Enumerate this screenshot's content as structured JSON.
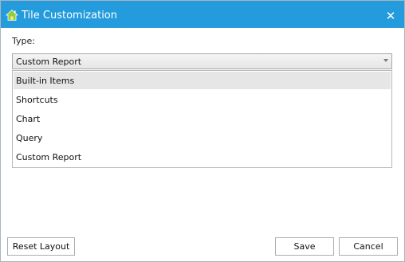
{
  "window": {
    "title": "Tile Customization",
    "close_glyph": "✕",
    "icon": "house-icon",
    "accent_color": "#239bdc"
  },
  "form": {
    "type_label": "Type:",
    "type_selected": "Custom Report",
    "type_options": [
      "Built-in Items",
      "Shortcuts",
      "Chart",
      "Query",
      "Custom Report"
    ],
    "highlighted_option": "Built-in Items"
  },
  "footer": {
    "reset_label": "Reset Layout",
    "save_label": "Save",
    "cancel_label": "Cancel"
  }
}
